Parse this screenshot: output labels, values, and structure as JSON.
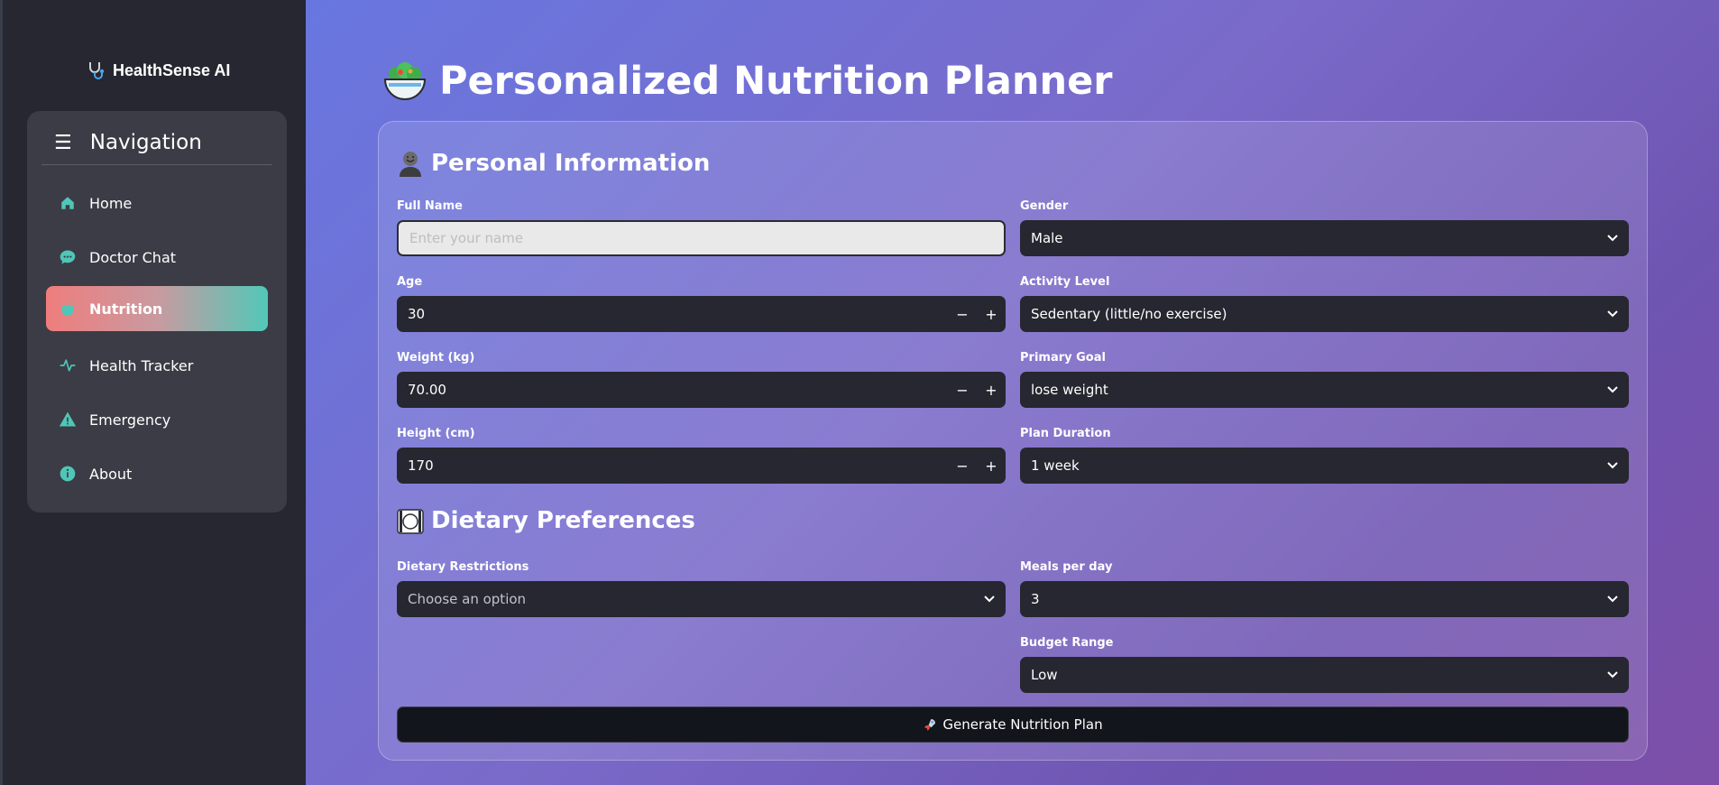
{
  "app": {
    "brand": "HealthSense AI"
  },
  "sidebar": {
    "header": "Navigation",
    "items": [
      {
        "label": "Home",
        "icon": "home-icon"
      },
      {
        "label": "Doctor Chat",
        "icon": "chat-icon"
      },
      {
        "label": "Nutrition",
        "icon": "apple-icon",
        "active": true
      },
      {
        "label": "Health Tracker",
        "icon": "activity-icon"
      },
      {
        "label": "Emergency",
        "icon": "warning-icon"
      },
      {
        "label": "About",
        "icon": "info-icon"
      }
    ],
    "accent": "#4fc6b8"
  },
  "main": {
    "title": "Personalized Nutrition Planner",
    "personal": {
      "heading": "Personal Information",
      "full_name": {
        "label": "Full Name",
        "placeholder": "Enter your name",
        "value": ""
      },
      "gender": {
        "label": "Gender",
        "value": "Male"
      },
      "age": {
        "label": "Age",
        "value": "30"
      },
      "activity": {
        "label": "Activity Level",
        "value": "Sedentary (little/no exercise)"
      },
      "weight": {
        "label": "Weight (kg)",
        "value": "70.00"
      },
      "goal": {
        "label": "Primary Goal",
        "value": "lose weight"
      },
      "height": {
        "label": "Height (cm)",
        "value": "170"
      },
      "duration": {
        "label": "Plan Duration",
        "value": "1 week"
      }
    },
    "dietary": {
      "heading": "Dietary Preferences",
      "restrictions": {
        "label": "Dietary Restrictions",
        "placeholder": "Choose an option"
      },
      "meals": {
        "label": "Meals per day",
        "value": "3"
      },
      "budget": {
        "label": "Budget Range",
        "value": "Low"
      }
    },
    "generate_button": "Generate Nutrition Plan",
    "stepper": {
      "minus": "−",
      "plus": "+"
    }
  }
}
